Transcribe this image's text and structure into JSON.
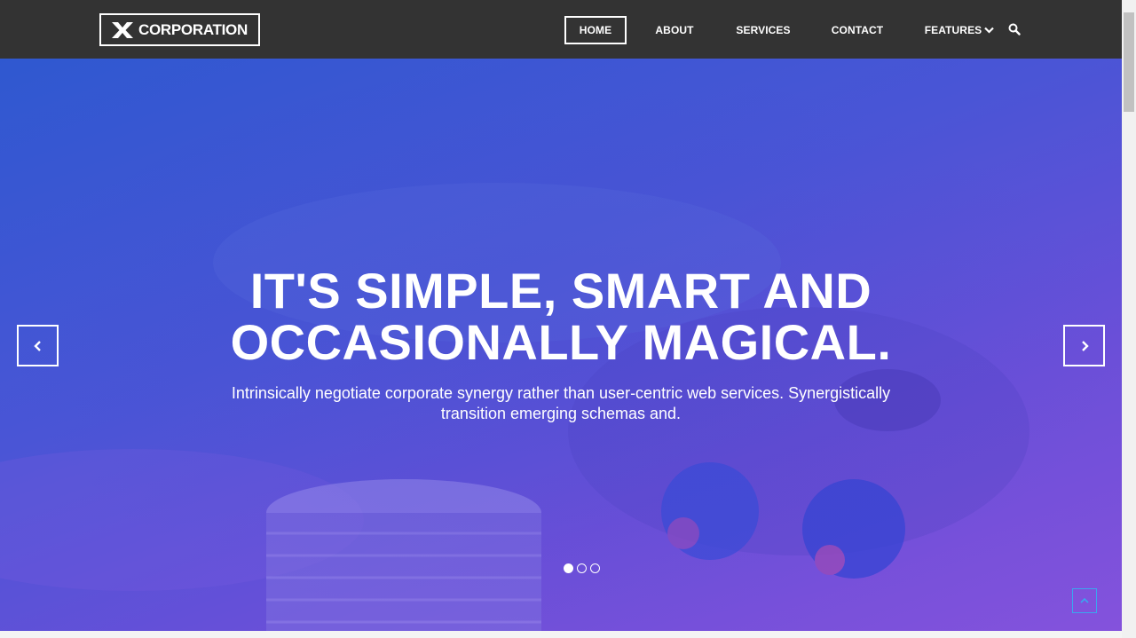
{
  "brand": {
    "logo_icon": "x-logo-icon",
    "name": "CORPORATION"
  },
  "nav": {
    "items": [
      {
        "label": "HOME",
        "active": true
      },
      {
        "label": "ABOUT"
      },
      {
        "label": "SERVICES"
      },
      {
        "label": "CONTACT"
      },
      {
        "label": "FEATURES",
        "icon": "chevron-down-icon"
      }
    ],
    "search_icon": "search-icon"
  },
  "hero": {
    "title_line1": "IT'S SIMPLE, SMART AND",
    "title_line2": "OCCASIONALLY MAGICAL.",
    "subtitle_line1": "Intrinsically negotiate corporate synergy rather than user-centric web services. Synergistically",
    "subtitle_line2": "transition emerging schemas and.",
    "prev_icon": "chevron-left-icon",
    "next_icon": "chevron-right-icon",
    "slides": 3,
    "active_slide": 1
  },
  "back_to_top_icon": "arrow-up-icon",
  "colors": {
    "navbar": "#333333",
    "hero_gradient_start": "#2f58d0",
    "hero_gradient_end": "#8452dc",
    "back_to_top_accent": "#3aa7f0"
  }
}
